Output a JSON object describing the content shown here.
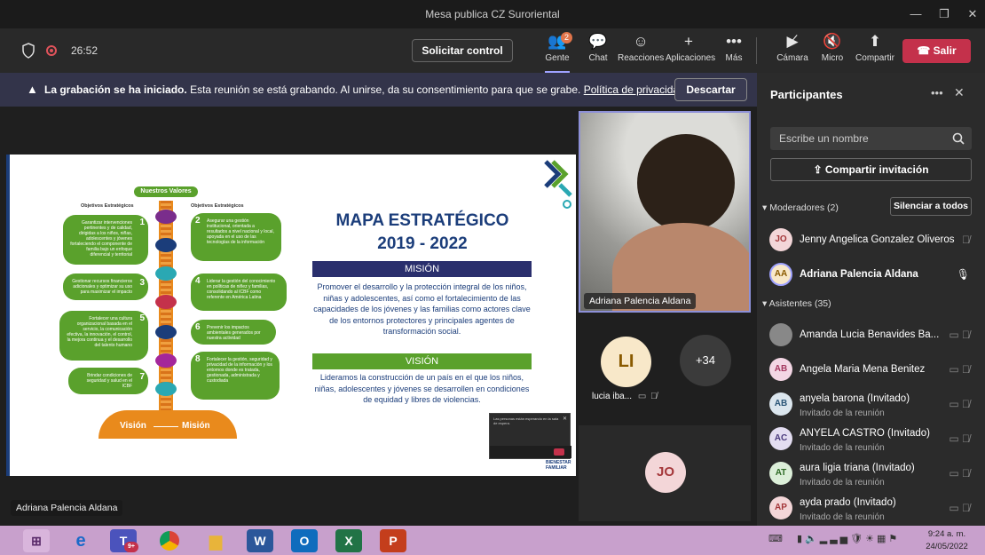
{
  "window": {
    "title": "Mesa publica CZ Suroriental"
  },
  "toolbar": {
    "timer": "26:52",
    "request_control": "Solicitar control",
    "people_label": "Gente",
    "people_badge": "2",
    "chat_label": "Chat",
    "reactions_label": "Reacciones",
    "apps_label": "Aplicaciones",
    "more_label": "Más",
    "camera_label": "Cámara",
    "mic_label": "Micro",
    "share_label": "Compartir",
    "leave_label": "Salir"
  },
  "banner": {
    "bold": "La grabación se ha iniciado.",
    "text": "Esta reunión se está grabando. Al unirse, da su consentimiento para que se grabe.",
    "link": "Política de privacidad",
    "dismiss": "Descartar"
  },
  "slide": {
    "values_title": "Nuestros Valores",
    "obj_left_title": "Objetivos Estratégicos",
    "obj_right_title": "Objetivos Estratégicos",
    "main_title_1": "MAPA ESTRATÉGICO",
    "main_title_2": "2019 - 2022",
    "mision_header": "MISIÓN",
    "mision_text": "Promover el desarrollo y la protección integral de los niños, niñas y adolescentes, así como el fortalecimiento de las capacidades de los jóvenes y las familias como actores clave de los entornos protectores y principales agentes de transformación social.",
    "vision_header": "VISIÓN",
    "vision_text": "Lideramos la construcción de un país en el que los niños, niñas, adolescentes y jóvenes se desarrollen en condiciones de equidad y libres de violencias.",
    "vision_label": "Visión",
    "mision_label": "Misión",
    "brand": "BIENESTAR FAMILIAR",
    "objectives": [
      {
        "num": "1",
        "text": "Garantizar intervenciones pertinentes y de calidad, dirigidas a los niños, niñas, adolescentes y jóvenes fortaleciendo el componente de familia bajo un enfoque diferencial y territorial"
      },
      {
        "num": "2",
        "text": "Asegurar una gestión institucional, orientada a resultados a nivel nacional y local, apoyada en el uso de las tecnologías de la información"
      },
      {
        "num": "3",
        "text": "Gestionar recursos financieros adicionales y optimizar su uso para maximizar el impacto"
      },
      {
        "num": "4",
        "text": "Liderar la gestión del conocimiento en políticas de niñez y familias, consolidando al ICBF como referente en América Latina"
      },
      {
        "num": "5",
        "text": "Fortalecer una cultura organizacional basada en el servicio, la comunicación efectiva, la innovación, el control, la mejora continua y el desarrollo del talento humano"
      },
      {
        "num": "6",
        "text": "Prevenir los impactos ambientales generados por nuestra actividad"
      },
      {
        "num": "7",
        "text": "Brindar condiciones de seguridad y salud en el ICBF"
      },
      {
        "num": "8",
        "text": "Fortalecer la gestión, seguridad y privacidad de la información y los entornos donde es tratada, gestionada, administrada y custodiada"
      }
    ],
    "mini_dialog": "Las personas están esperando en la sala de espera."
  },
  "video": {
    "speaker_name": "Adriana Palencia Aldana",
    "tile_li_initials": "LI",
    "tile_li_name": "lucia iba...",
    "overflow_count": "+34",
    "tile_jo_initials": "JO",
    "bottom_label": "Adriana Palencia Aldana"
  },
  "panel": {
    "title": "Participantes",
    "search_placeholder": "Escribe un nombre",
    "share_invite": "Compartir invitación",
    "moderators_header": "Moderadores (2)",
    "mute_all": "Silenciar a todos",
    "attendees_header": "Asistentes (35)",
    "moderators": [
      {
        "initials": "JO",
        "name": "Jenny Angelica Gonzalez Oliveros",
        "color": "#f3d6d8",
        "fg": "#a4373a"
      },
      {
        "initials": "AA",
        "name": "Adriana Palencia Aldana",
        "color": "#f8e8c9",
        "fg": "#8a5a00"
      }
    ],
    "attendees": [
      {
        "initials": "",
        "name": "Amanda Lucia Benavides Ba...",
        "status": "",
        "color": "#888888",
        "fg": "#fff"
      },
      {
        "initials": "AB",
        "name": "Angela Maria Mena Benitez",
        "status": "",
        "color": "#f3d6e4",
        "fg": "#a4375f"
      },
      {
        "initials": "AB",
        "name": "anyela barona (Invitado)",
        "status": "Invitado de la reunión",
        "color": "#dbe6ee",
        "fg": "#2a5577"
      },
      {
        "initials": "AC",
        "name": "ANYELA CASTRO (Invitado)",
        "status": "Invitado de la reunión",
        "color": "#e3ddf1",
        "fg": "#4b3b7d"
      },
      {
        "initials": "AT",
        "name": "aura ligia triana (Invitado)",
        "status": "Invitado de la reunión",
        "color": "#dcefd9",
        "fg": "#2e6b25"
      },
      {
        "initials": "AP",
        "name": "ayda prado (Invitado)",
        "status": "Invitado de la reunión",
        "color": "#f3d6d8",
        "fg": "#a4373a"
      }
    ]
  },
  "taskbar": {
    "time": "9:24 a. m.",
    "date": "24/05/2022",
    "teams_badge": "9+"
  }
}
